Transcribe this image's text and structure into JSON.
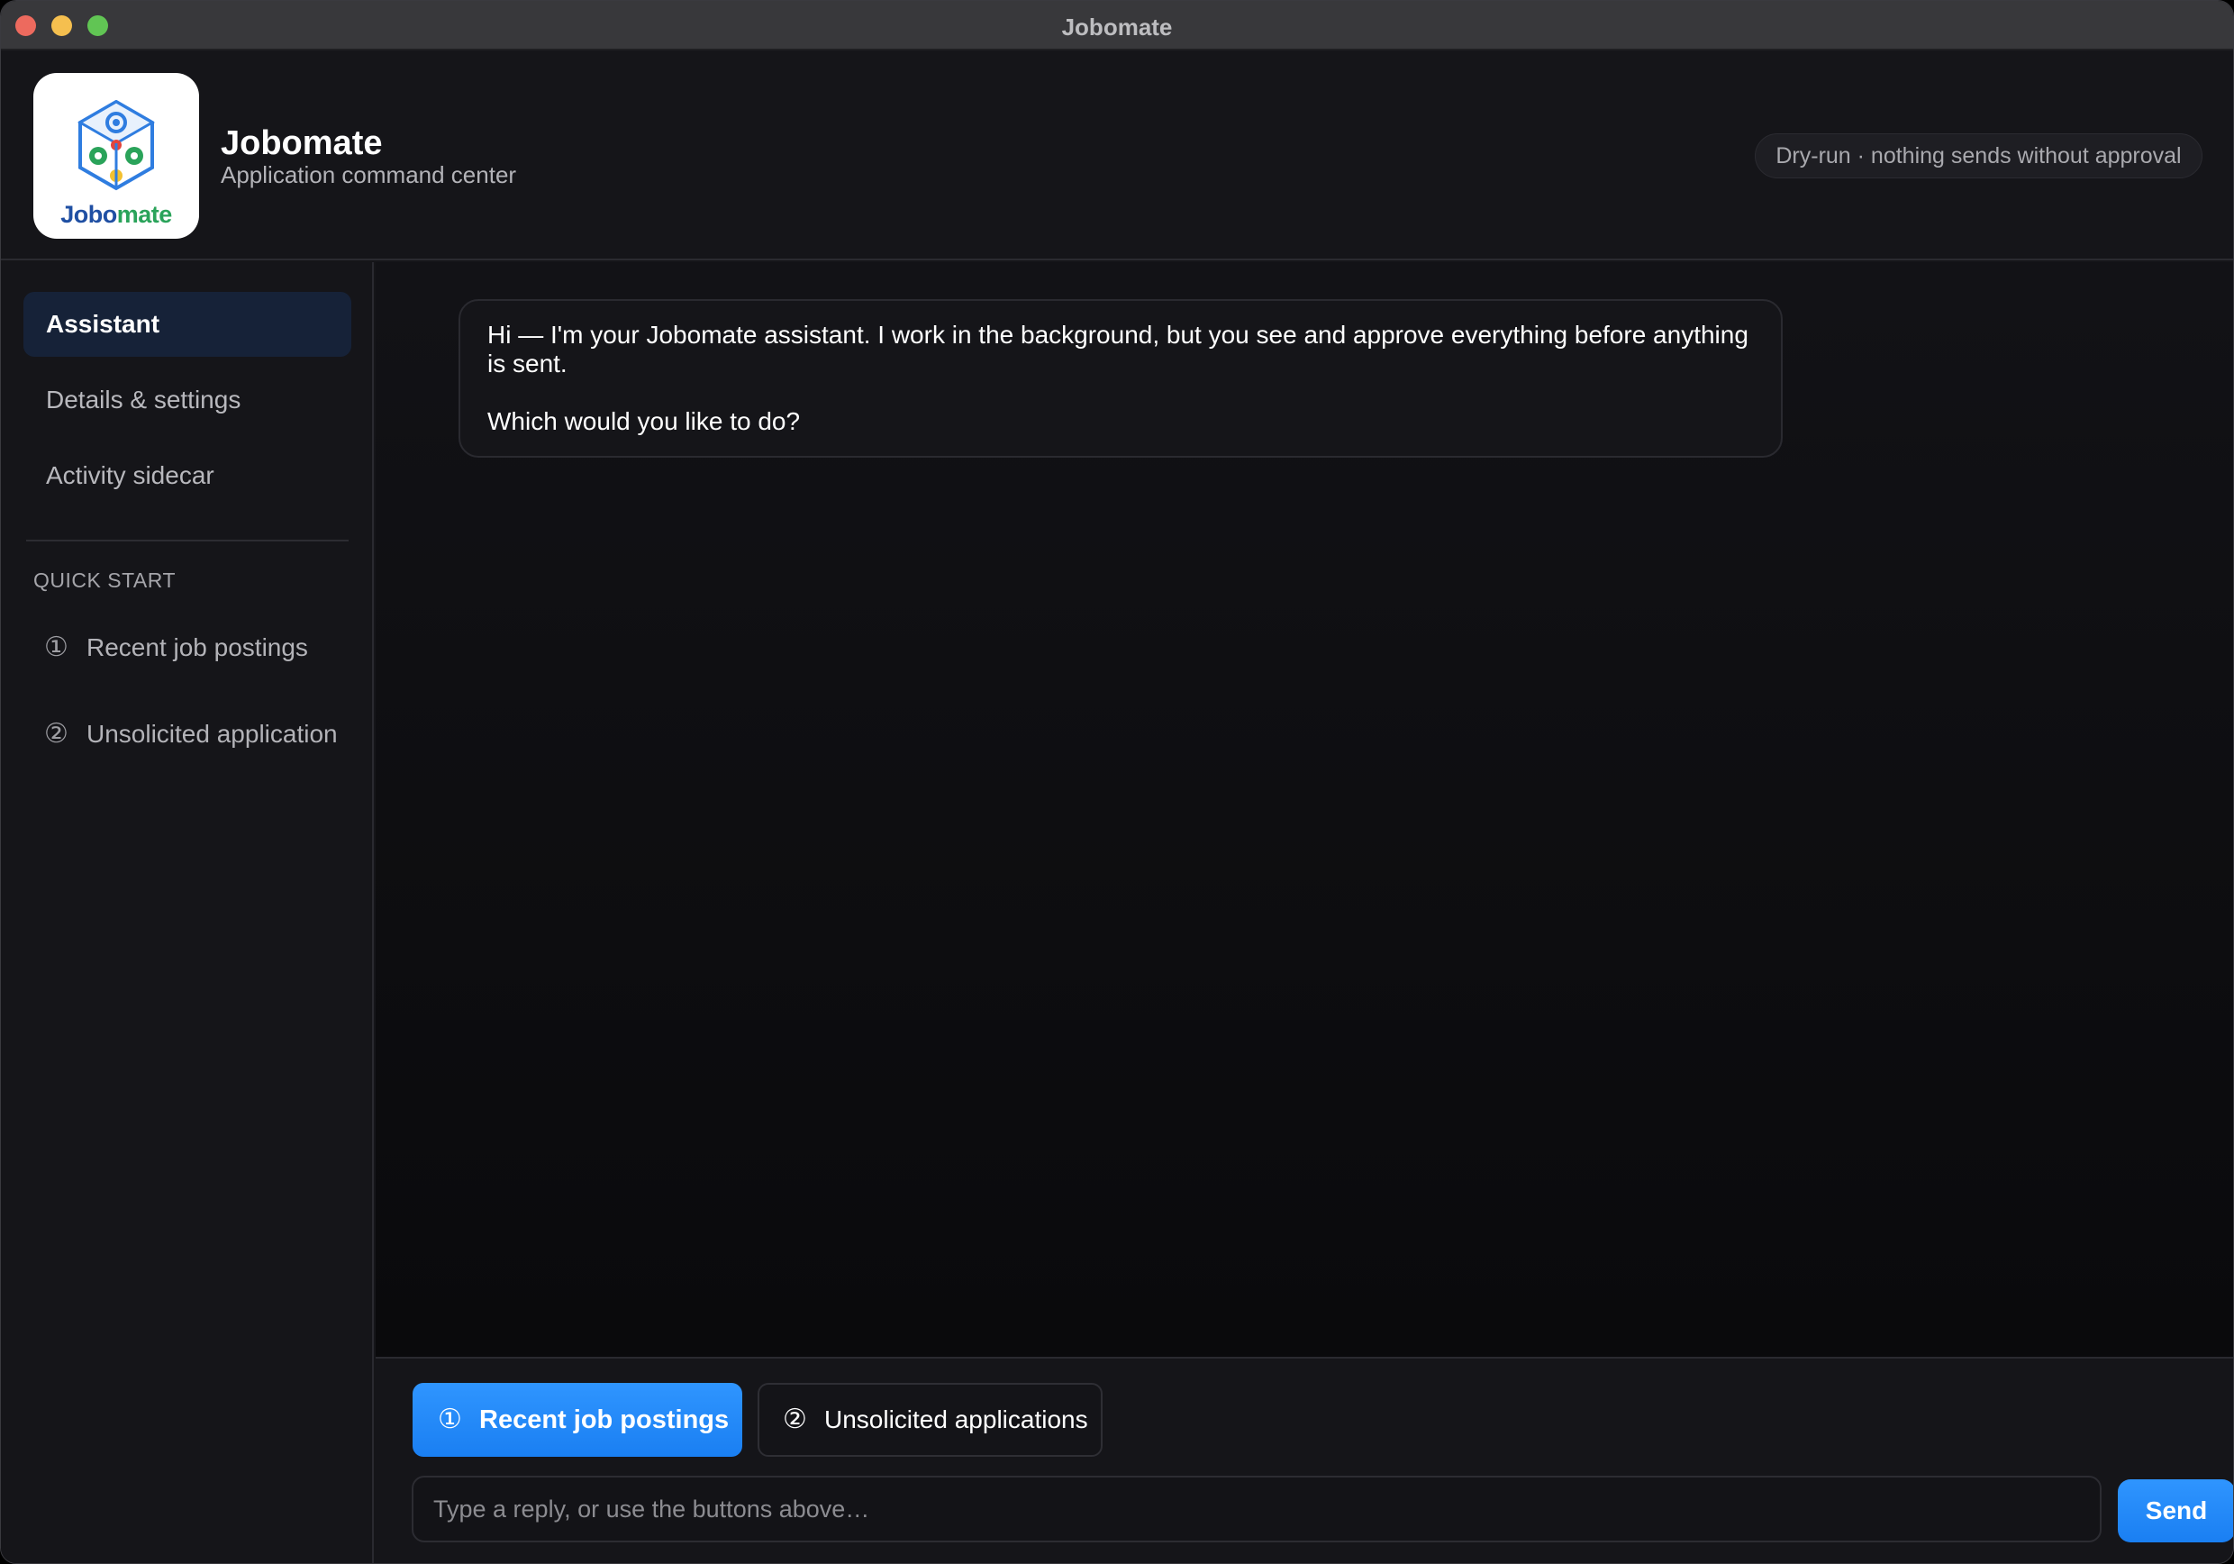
{
  "window": {
    "title": "Jobomate"
  },
  "header": {
    "app_name": "Jobomate",
    "subtitle": "Application command center",
    "logo_text_a": "Jobo",
    "logo_text_b": "mate",
    "dry_run_badge": "Dry-run · nothing sends without approval"
  },
  "sidebar": {
    "nav": [
      {
        "label": "Assistant",
        "active": true
      },
      {
        "label": "Details & settings",
        "active": false
      },
      {
        "label": "Activity sidecar",
        "active": false
      }
    ],
    "section_label": "QUICK START",
    "quick_start": [
      {
        "num": "①",
        "label": "Recent job postings"
      },
      {
        "num": "②",
        "label": "Unsolicited application"
      }
    ]
  },
  "chat": {
    "assistant_message": {
      "line1": "Hi — I'm your Jobomate assistant. I work in the background, but you see and approve everything before anything is sent.",
      "line2": "Which would you like to do?"
    }
  },
  "composer": {
    "choice_1": {
      "num": "①",
      "label": "Recent job postings"
    },
    "choice_2": {
      "num": "②",
      "label": "Unsolicited applications"
    },
    "input_placeholder": "Type a reply, or use the buttons above…",
    "input_value": "",
    "send_label": "Send"
  },
  "colors": {
    "accent": "#1a7ff2",
    "active_nav_bg": "#162238",
    "brand_blue": "#1f4fa3",
    "brand_green": "#2aa35a"
  },
  "icons": {
    "logo": "gear-cube-logo-icon"
  }
}
